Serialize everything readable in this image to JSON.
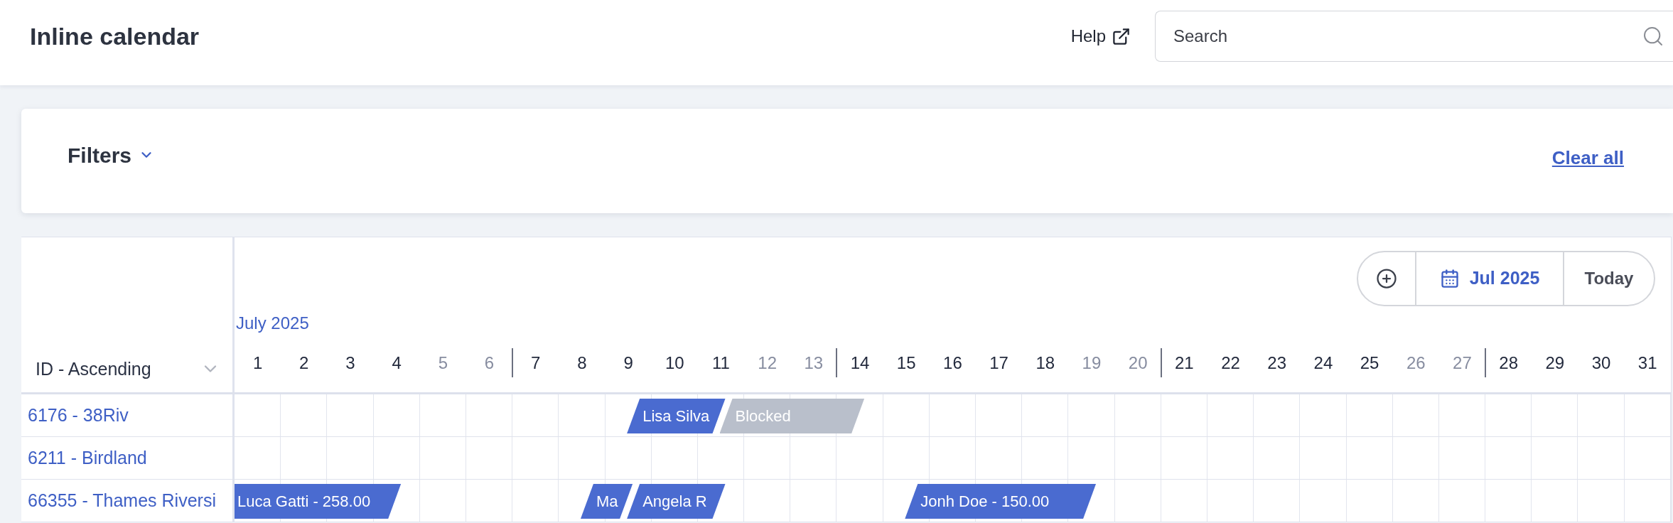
{
  "header": {
    "title": "Inline calendar",
    "help_link": "Help",
    "search": {
      "placeholder": "Search"
    }
  },
  "filters": {
    "title": "Filters",
    "expanded": false,
    "clear_link": "Clear all"
  },
  "calendar": {
    "sort": {
      "label": "ID - Ascending"
    },
    "toolbar": {
      "month_button": "Jul 2025",
      "today_button": "Today"
    },
    "month_label": "July 2025",
    "days": [
      {
        "label": "1",
        "weekend": false
      },
      {
        "label": "2",
        "weekend": false
      },
      {
        "label": "3",
        "weekend": false
      },
      {
        "label": "4",
        "weekend": false
      },
      {
        "label": "5",
        "weekend": true
      },
      {
        "label": "6",
        "weekend": true
      },
      {
        "label": "7",
        "weekend": false
      },
      {
        "label": "8",
        "weekend": false
      },
      {
        "label": "9",
        "weekend": false
      },
      {
        "label": "10",
        "weekend": false
      },
      {
        "label": "11",
        "weekend": false
      },
      {
        "label": "12",
        "weekend": true
      },
      {
        "label": "13",
        "weekend": true
      },
      {
        "label": "14",
        "weekend": false
      },
      {
        "label": "15",
        "weekend": false
      },
      {
        "label": "16",
        "weekend": false
      },
      {
        "label": "17",
        "weekend": false
      },
      {
        "label": "18",
        "weekend": false
      },
      {
        "label": "19",
        "weekend": true
      },
      {
        "label": "20",
        "weekend": true
      },
      {
        "label": "21",
        "weekend": false
      },
      {
        "label": "22",
        "weekend": false
      },
      {
        "label": "23",
        "weekend": false
      },
      {
        "label": "24",
        "weekend": false
      },
      {
        "label": "25",
        "weekend": false
      },
      {
        "label": "26",
        "weekend": true
      },
      {
        "label": "27",
        "weekend": true
      },
      {
        "label": "28",
        "weekend": false
      },
      {
        "label": "29",
        "weekend": false
      },
      {
        "label": "30",
        "weekend": false
      },
      {
        "label": "31",
        "weekend": false
      }
    ],
    "rows": [
      {
        "label": "6176 - 38Riv",
        "cells": [
          {
            "kind": "free"
          },
          {
            "kind": "free"
          },
          {
            "kind": "free"
          },
          {
            "kind": "free"
          },
          {
            "kind": "free"
          },
          {
            "kind": "free"
          },
          {
            "kind": "free"
          },
          {
            "kind": "free"
          },
          {
            "kind": "booking",
            "label": "Lisa Silva",
            "check_in": true
          },
          {
            "kind": "booking"
          },
          {
            "kind": "blocked",
            "label": "Blocked",
            "check_in": true
          },
          {
            "kind": "blocked"
          },
          {
            "kind": "blocked"
          },
          {
            "kind": "free"
          },
          {
            "kind": "free"
          },
          {
            "kind": "free"
          },
          {
            "kind": "free"
          },
          {
            "kind": "free"
          },
          {
            "kind": "free"
          },
          {
            "kind": "free"
          },
          {
            "kind": "free"
          },
          {
            "kind": "free"
          },
          {
            "kind": "free"
          },
          {
            "kind": "free"
          },
          {
            "kind": "free"
          },
          {
            "kind": "free"
          },
          {
            "kind": "free"
          },
          {
            "kind": "free"
          },
          {
            "kind": "free"
          },
          {
            "kind": "free"
          },
          {
            "kind": "free"
          }
        ]
      },
      {
        "label": "6211 - Birdland",
        "cells": [
          {
            "kind": "free"
          },
          {
            "kind": "free"
          },
          {
            "kind": "free"
          },
          {
            "kind": "free"
          },
          {
            "kind": "free"
          },
          {
            "kind": "free"
          },
          {
            "kind": "free"
          },
          {
            "kind": "free"
          },
          {
            "kind": "free"
          },
          {
            "kind": "free"
          },
          {
            "kind": "free"
          },
          {
            "kind": "free"
          },
          {
            "kind": "free"
          },
          {
            "kind": "free"
          },
          {
            "kind": "free"
          },
          {
            "kind": "free"
          },
          {
            "kind": "free"
          },
          {
            "kind": "free"
          },
          {
            "kind": "free"
          },
          {
            "kind": "free"
          },
          {
            "kind": "free"
          },
          {
            "kind": "free"
          },
          {
            "kind": "free"
          },
          {
            "kind": "free"
          },
          {
            "kind": "free"
          },
          {
            "kind": "free"
          },
          {
            "kind": "free"
          },
          {
            "kind": "free"
          },
          {
            "kind": "free"
          },
          {
            "kind": "free"
          },
          {
            "kind": "free"
          }
        ]
      },
      {
        "label": "66355 - Thames Riversi",
        "cells": [
          {
            "kind": "booking",
            "label": "Luca Gatti - 258.00",
            "check_in": false
          },
          {
            "kind": "booking"
          },
          {
            "kind": "booking"
          },
          {
            "kind": "free"
          },
          {
            "kind": "free"
          },
          {
            "kind": "free"
          },
          {
            "kind": "free"
          },
          {
            "kind": "booking",
            "label": "Ma",
            "check_in": true
          },
          {
            "kind": "booking",
            "label": "Angela R",
            "check_in": true
          },
          {
            "kind": "booking"
          },
          {
            "kind": "free"
          },
          {
            "kind": "free"
          },
          {
            "kind": "free"
          },
          {
            "kind": "free"
          },
          {
            "kind": "booking",
            "label": "Jonh Doe - 150.00",
            "check_in": true
          },
          {
            "kind": "booking"
          },
          {
            "kind": "booking"
          },
          {
            "kind": "booking"
          },
          {
            "kind": "free"
          },
          {
            "kind": "free"
          },
          {
            "kind": "free"
          },
          {
            "kind": "free"
          },
          {
            "kind": "free"
          },
          {
            "kind": "free"
          },
          {
            "kind": "free"
          },
          {
            "kind": "free"
          },
          {
            "kind": "free"
          },
          {
            "kind": "free"
          },
          {
            "kind": "free"
          },
          {
            "kind": "free"
          },
          {
            "kind": "free"
          }
        ]
      }
    ]
  }
}
